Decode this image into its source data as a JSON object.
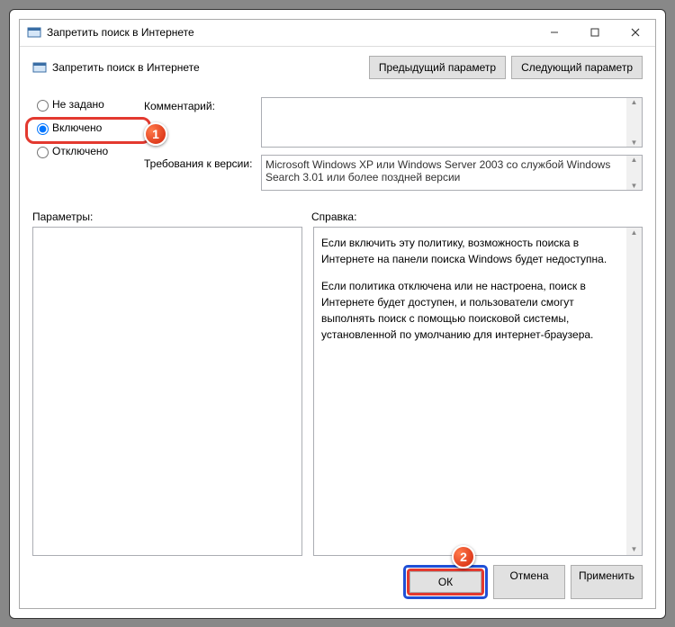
{
  "window": {
    "title": "Запретить поиск в Интернете"
  },
  "header": {
    "policy_name": "Запретить поиск в Интернете",
    "prev_btn": "Предыдущий параметр",
    "next_btn": "Следующий параметр"
  },
  "radios": {
    "not_configured": "Не задано",
    "enabled": "Включено",
    "disabled": "Отключено"
  },
  "fields": {
    "comment_label": "Комментарий:",
    "comment_value": "",
    "supported_label": "Требования к версии:",
    "supported_value": "Microsoft Windows XP или Windows Server 2003 со службой Windows Search 3.01 или более поздней версии"
  },
  "lower": {
    "options_label": "Параметры:",
    "help_label": "Справка:",
    "help_p1": "Если включить эту политику, возможность поиска в Интернете на панели поиска Windows будет недоступна.",
    "help_p2": "Если политика отключена или не настроена, поиск в Интернете будет доступен, и пользователи смогут выполнять поиск с помощью поисковой системы, установленной по умолчанию для интернет-браузера."
  },
  "buttons": {
    "ok": "ОК",
    "cancel": "Отмена",
    "apply": "Применить"
  },
  "badges": {
    "b1": "1",
    "b2": "2"
  }
}
